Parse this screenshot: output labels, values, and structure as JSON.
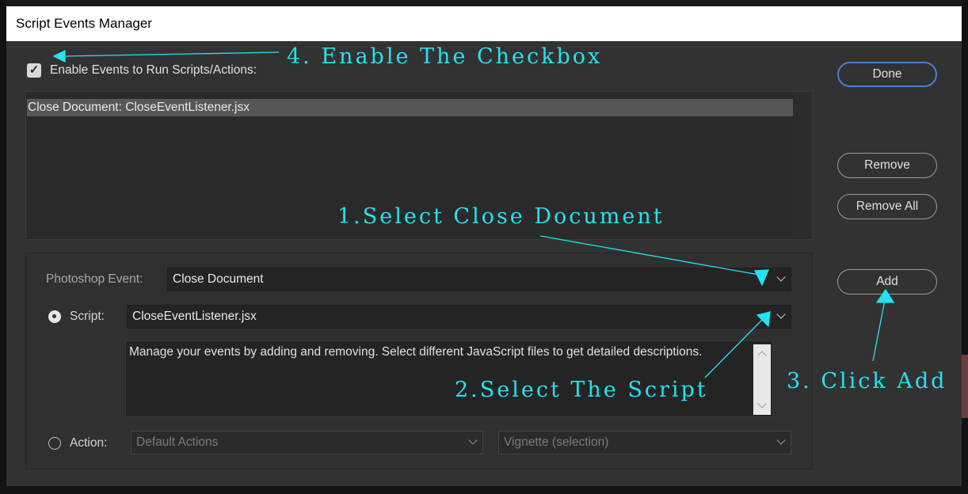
{
  "window": {
    "title": "Script Events Manager"
  },
  "enable_events": {
    "checked": true,
    "label": "Enable Events to Run Scripts/Actions:"
  },
  "events_list": {
    "items": [
      {
        "label": "Close Document: CloseEventListener.jsx",
        "selected": true
      }
    ]
  },
  "buttons": {
    "done": "Done",
    "remove": "Remove",
    "remove_all": "Remove All",
    "add": "Add"
  },
  "form": {
    "photoshop_event": {
      "label": "Photoshop Event:",
      "value": "Close Document"
    },
    "script": {
      "label": "Script:",
      "value": "CloseEventListener.jsx",
      "selected": true
    },
    "description": "Manage your events by adding and removing. Select different JavaScript files to get detailed descriptions.",
    "action": {
      "label": "Action:",
      "set_value": "Default Actions",
      "action_value": "Vignette (selection)",
      "selected": false
    }
  },
  "annotations": {
    "step1": "1.Select Close Document",
    "step2": "2.Select The Script",
    "step3": "3. Click Add",
    "step4": "4. Enable The Checkbox",
    "color": "#22e3f0"
  }
}
